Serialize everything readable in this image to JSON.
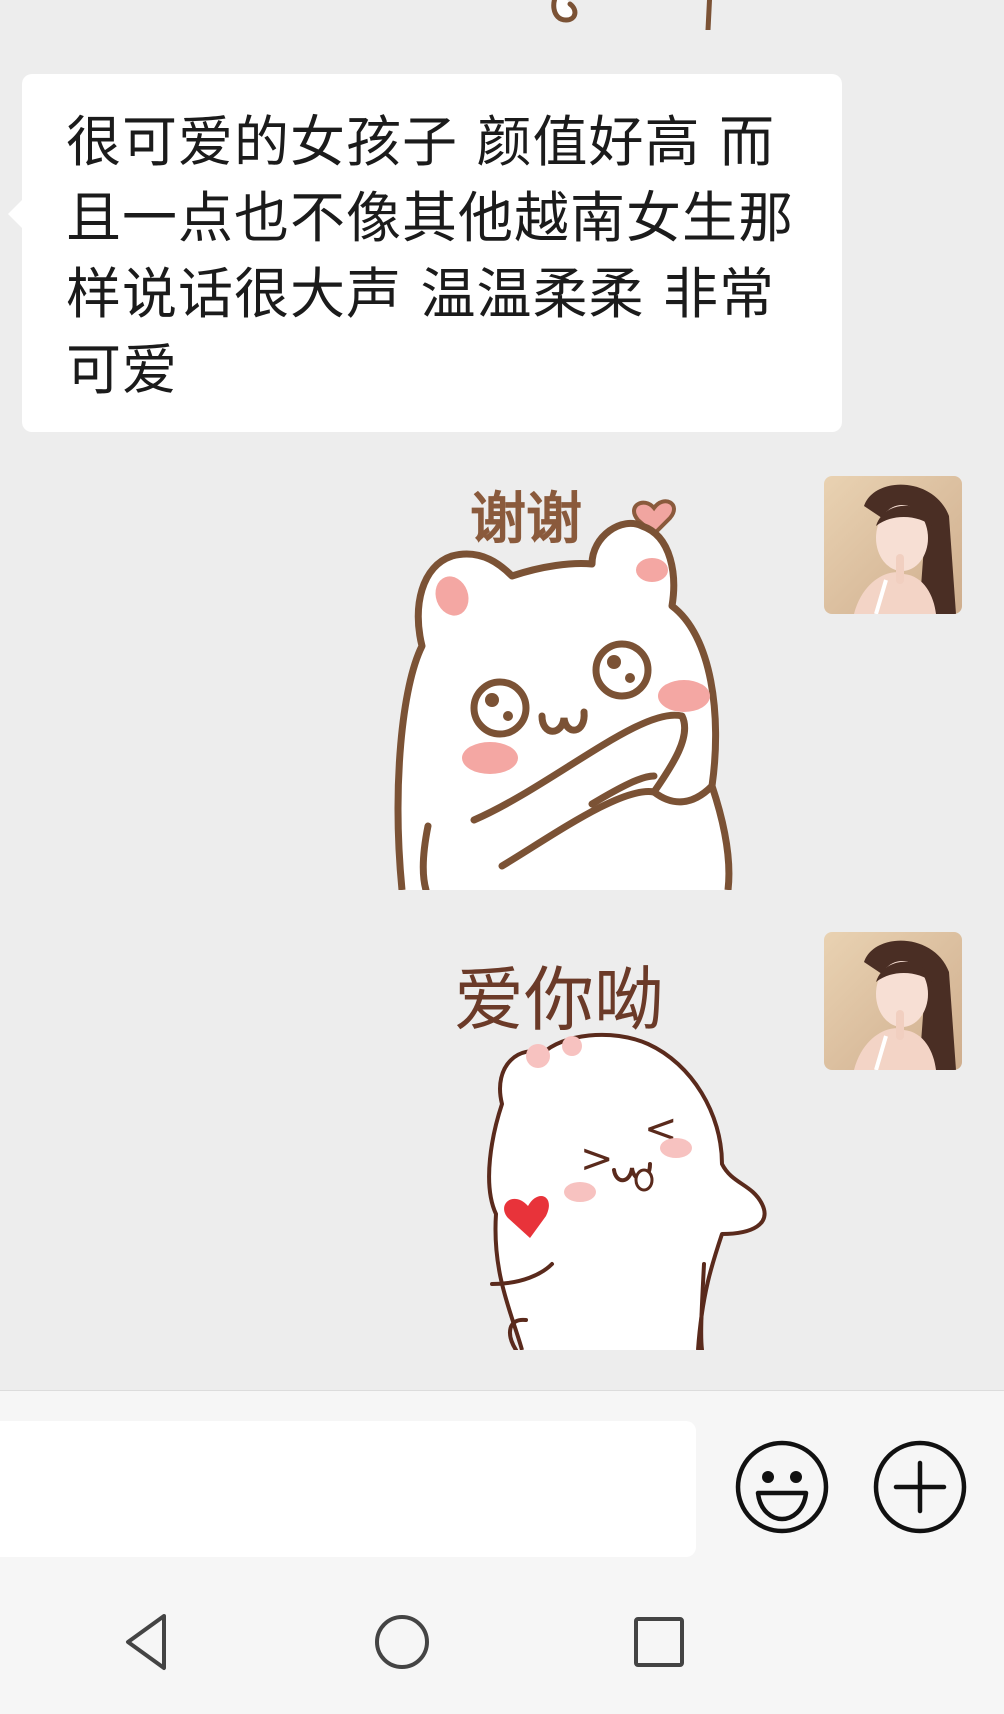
{
  "chat": {
    "incoming_message": "很可爱的女孩子 颜值好高 而且一点也不像其他越南女生那样说话很大声 温温柔柔 非常可爱",
    "outgoing": [
      {
        "sticker_text": "谢谢",
        "sticker": "cat-thank-you-sticker"
      },
      {
        "sticker_text": "爱你呦",
        "sticker": "bear-love-you-sticker"
      }
    ]
  },
  "input": {
    "value": "",
    "placeholder": ""
  },
  "icons": {
    "emoji": "smiley-face-icon",
    "more": "plus-circle-icon",
    "nav_back": "triangle-back-icon",
    "nav_home": "circle-home-icon",
    "nav_recents": "square-recents-icon"
  },
  "colors": {
    "chat_background": "#ededed",
    "bubble": "#ffffff",
    "sticker_outline": "#7b5235",
    "blush": "#f4a7a3",
    "heart_red": "#e8333a"
  }
}
